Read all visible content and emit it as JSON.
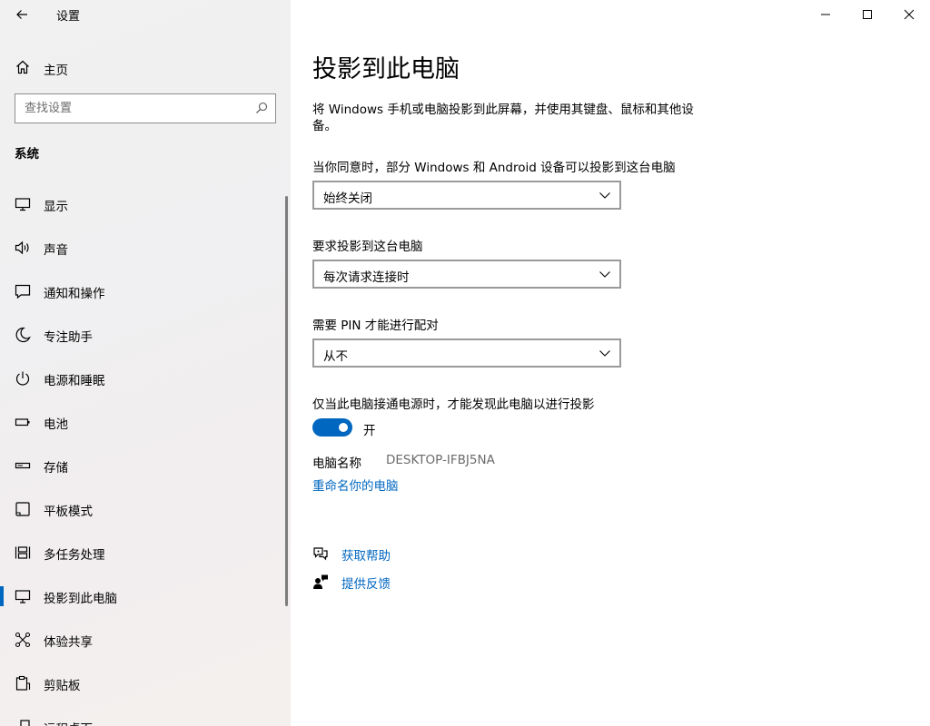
{
  "app": {
    "title": "设置"
  },
  "sidebar": {
    "home_label": "主页",
    "search_placeholder": "查找设置",
    "section_title": "系统",
    "items": [
      {
        "label": "显示",
        "icon": "monitor-icon"
      },
      {
        "label": "声音",
        "icon": "speaker-icon"
      },
      {
        "label": "通知和操作",
        "icon": "notification-icon"
      },
      {
        "label": "专注助手",
        "icon": "moon-icon"
      },
      {
        "label": "电源和睡眠",
        "icon": "power-icon"
      },
      {
        "label": "电池",
        "icon": "battery-icon"
      },
      {
        "label": "存储",
        "icon": "storage-icon"
      },
      {
        "label": "平板模式",
        "icon": "tablet-icon"
      },
      {
        "label": "多任务处理",
        "icon": "multitask-icon"
      },
      {
        "label": "投影到此电脑",
        "icon": "project-icon",
        "active": true
      },
      {
        "label": "体验共享",
        "icon": "share-icon"
      },
      {
        "label": "剪贴板",
        "icon": "clipboard-icon"
      },
      {
        "label": "远程桌面",
        "icon": "remote-desktop-icon"
      }
    ]
  },
  "main": {
    "title": "投影到此电脑",
    "description": "将 Windows 手机或电脑投影到此屏幕，并使用其键盘、鼠标和其他设备。",
    "setting1": {
      "label": "当你同意时，部分 Windows 和 Android 设备可以投影到这台电脑",
      "value": "始终关闭"
    },
    "setting2": {
      "label": "要求投影到这台电脑",
      "value": "每次请求连接时"
    },
    "setting3": {
      "label": "需要 PIN 才能进行配对",
      "value": "从不"
    },
    "power": {
      "label": "仅当此电脑接通电源时，才能发现此电脑以进行投影",
      "state": "开",
      "on": true
    },
    "pc_name": {
      "label": "电脑名称",
      "value": "DESKTOP-IFBJ5NA"
    },
    "rename_link": "重命名你的电脑",
    "help_link": "获取帮助",
    "feedback_link": "提供反馈"
  },
  "colors": {
    "accent": "#0067c0",
    "sidebar_bg": "#f1f0f1",
    "secondary_text": "#6b6b6b"
  }
}
